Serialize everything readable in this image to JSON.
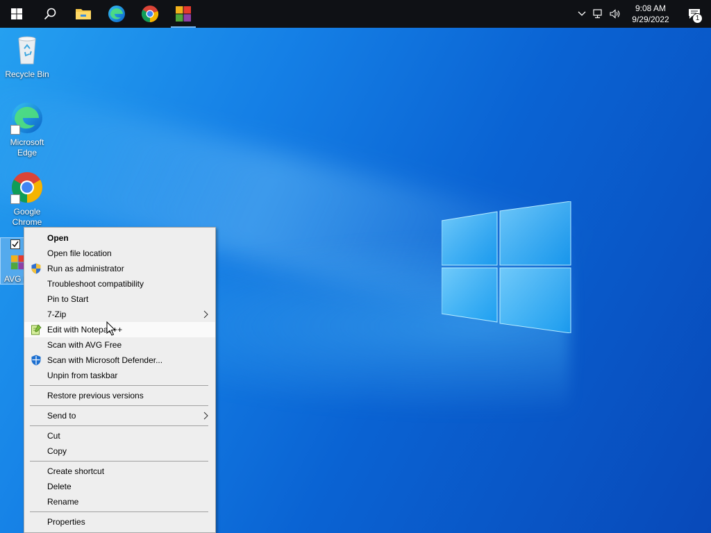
{
  "taskbar": {
    "clock_time": "9:08 AM",
    "clock_date": "9/29/2022",
    "notification_count": "1",
    "pinned": [
      "start-icon",
      "search-icon",
      "file-explorer-icon",
      "edge-icon",
      "chrome-icon",
      "avg-icon"
    ],
    "tray": [
      "chevron-up-icon",
      "network-icon",
      "volume-icon"
    ]
  },
  "desktop": {
    "icons": [
      {
        "label": "Recycle Bin",
        "icon": "recycle-bin-icon"
      },
      {
        "label": "Microsoft Edge",
        "icon": "edge-icon"
      },
      {
        "label": "Google Chrome",
        "icon": "chrome-icon"
      },
      {
        "label": "AVG I",
        "icon": "avg-icon"
      }
    ]
  },
  "context_menu": {
    "items": [
      {
        "label": "Open"
      },
      {
        "label": "Open file location"
      },
      {
        "label": "Run as administrator"
      },
      {
        "label": "Troubleshoot compatibility"
      },
      {
        "label": "Pin to Start"
      },
      {
        "label": "7-Zip"
      },
      {
        "label": "Edit with Notepad++"
      },
      {
        "label": "Scan with AVG Free"
      },
      {
        "label": "Scan with Microsoft Defender..."
      },
      {
        "label": "Unpin from taskbar"
      },
      {
        "label": "Restore previous versions"
      },
      {
        "label": "Send to"
      },
      {
        "label": "Cut"
      },
      {
        "label": "Copy"
      },
      {
        "label": "Create shortcut"
      },
      {
        "label": "Delete"
      },
      {
        "label": "Rename"
      },
      {
        "label": "Properties"
      }
    ]
  },
  "colors": {
    "taskbar": "#0f1115",
    "desktop_accent": "#0a63d3",
    "menu_bg": "#eeeeee",
    "menu_hover": "#fafafa"
  }
}
